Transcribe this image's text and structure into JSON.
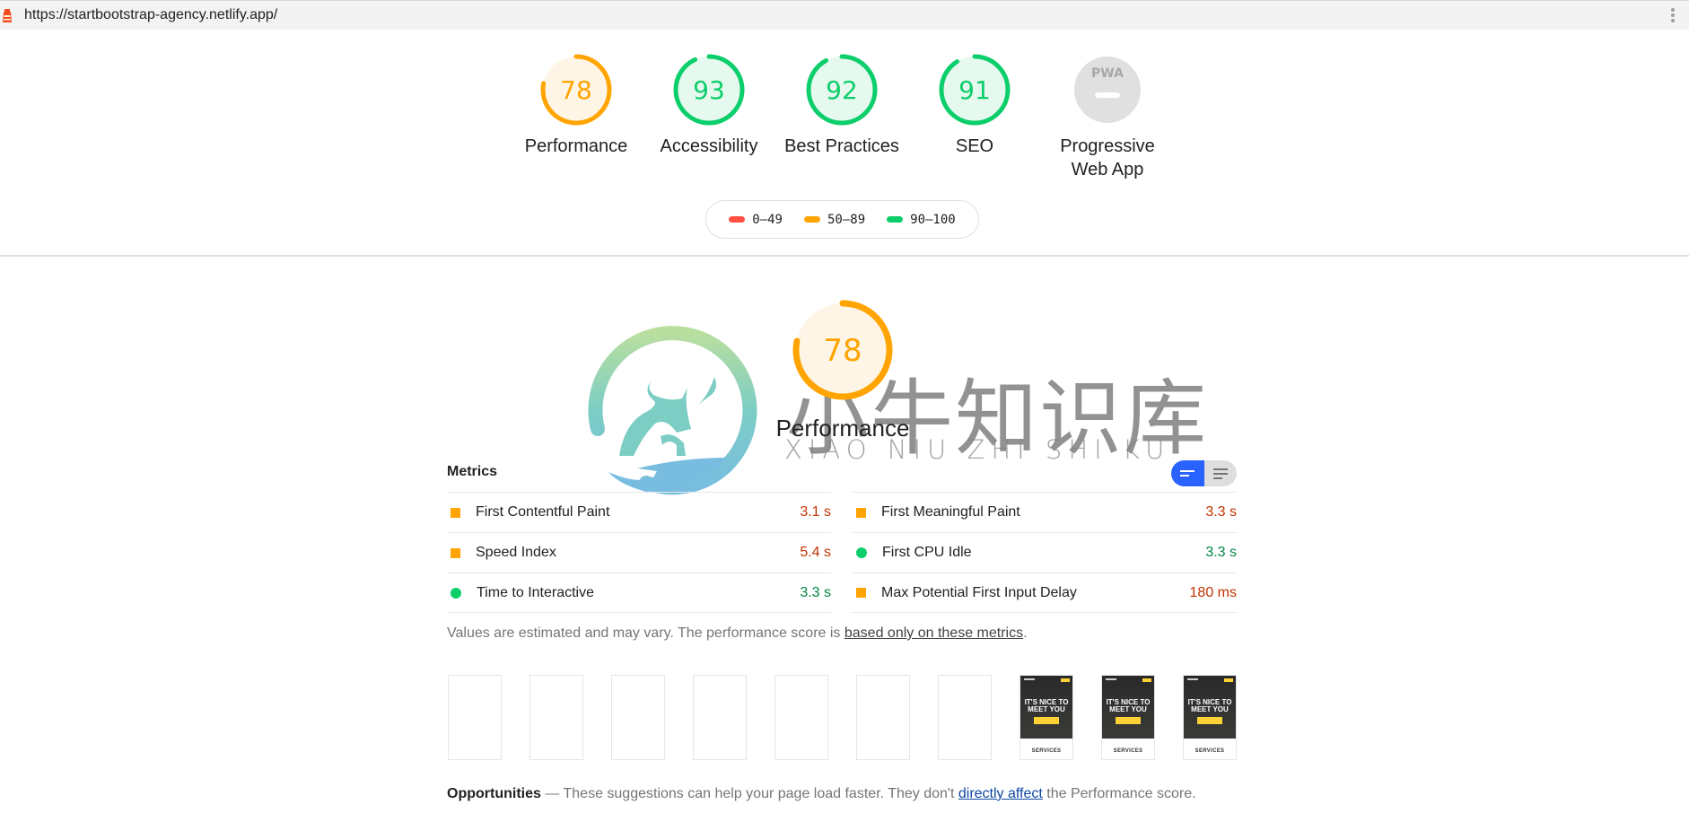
{
  "topbar": {
    "url": "https://startbootstrap-agency.netlify.app/",
    "icon": "lighthouse-icon",
    "menu_icon": "kebab-menu-icon"
  },
  "colors": {
    "fail": "#ff4e42",
    "average": "#ffa400",
    "pass": "#0cce6b",
    "average_text": "#c33300",
    "pass_text": "#018642",
    "average_fill": "#fff5e6",
    "pass_fill": "#e6f9ef",
    "na_fill": "#e0e0e0",
    "toggle_active": "#2962ff",
    "link": "#0d47a1"
  },
  "categories": [
    {
      "label": "Performance",
      "score": 78,
      "rating": "average"
    },
    {
      "label": "Accessibility",
      "score": 93,
      "rating": "pass"
    },
    {
      "label": "Best Practices",
      "score": 92,
      "rating": "pass"
    },
    {
      "label": "SEO",
      "score": 91,
      "rating": "pass"
    },
    {
      "label": "Progressive Web App",
      "label_line1": "Progressive",
      "label_line2": "Web App",
      "score": null,
      "rating": "na",
      "badge": "PWA"
    }
  ],
  "legend": [
    {
      "label": "0–49",
      "rating": "fail"
    },
    {
      "label": "50–89",
      "rating": "average"
    },
    {
      "label": "90–100",
      "rating": "pass"
    }
  ],
  "performance": {
    "score": 78,
    "label": "Performance",
    "metrics_title": "Metrics",
    "toggle": {
      "active": "summary-view",
      "options": [
        "summary-view",
        "detailed-view"
      ]
    },
    "metrics_left": [
      {
        "name": "First Contentful Paint",
        "value": "3.1 s",
        "rating": "average"
      },
      {
        "name": "Speed Index",
        "value": "5.4 s",
        "rating": "average"
      },
      {
        "name": "Time to Interactive",
        "value": "3.3 s",
        "rating": "pass"
      }
    ],
    "metrics_right": [
      {
        "name": "First Meaningful Paint",
        "value": "3.3 s",
        "rating": "average"
      },
      {
        "name": "First CPU Idle",
        "value": "3.3 s",
        "rating": "pass"
      },
      {
        "name": "Max Potential First Input Delay",
        "value": "180 ms",
        "rating": "average"
      }
    ],
    "note_prefix": "Values are estimated and may vary. The performance score is ",
    "note_link": "based only on these metrics",
    "note_suffix": ".",
    "filmstrip": [
      {
        "type": "blank"
      },
      {
        "type": "blank"
      },
      {
        "type": "blank"
      },
      {
        "type": "blank"
      },
      {
        "type": "blank"
      },
      {
        "type": "blank"
      },
      {
        "type": "blank"
      },
      {
        "type": "screenshot",
        "headline": "IT'S NICE TO MEET YOU",
        "section": "SERVICES"
      },
      {
        "type": "screenshot",
        "headline": "IT'S NICE TO MEET YOU",
        "section": "SERVICES"
      },
      {
        "type": "screenshot",
        "headline": "IT'S NICE TO MEET YOU",
        "section": "SERVICES"
      }
    ]
  },
  "opportunities": {
    "title": "Opportunities",
    "text_prefix": " — These suggestions can help your page load faster. They don't ",
    "link": "directly affect",
    "text_suffix": " the Performance score."
  },
  "watermark": {
    "chinese": "小牛知识库",
    "pinyin": "XIAO NIU ZHI SHI KU"
  }
}
